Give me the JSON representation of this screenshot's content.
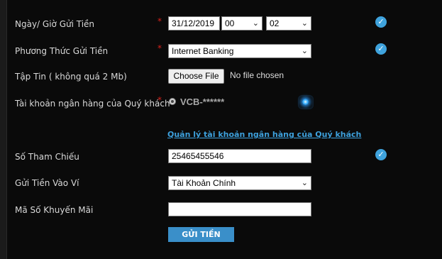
{
  "form": {
    "date_label": "Ngày/ Giờ Gửi Tiền",
    "date_value": "31/12/2019",
    "hour_value": "00",
    "minute_value": "02",
    "method_label": "Phương Thức Gửi Tiền",
    "method_value": "Internet Banking",
    "file_label": "Tập Tin ( không quá 2 Mb)",
    "file_button": "Choose File",
    "file_status": "No file chosen",
    "account_label": "Tài khoản ngân hàng của Quý khách",
    "account_option": "VCB-******",
    "manage_link": "Quản lý tài khoản ngân hàng của Quý khách",
    "reference_label": "Số Tham Chiếu",
    "reference_value": "25465455546",
    "wallet_label": "Gửi Tiền Vào Ví",
    "wallet_value": "Tài Khoản Chính",
    "promo_label": "Mã Số Khuyến Mãi",
    "promo_value": "",
    "submit_label": "GỬI TIỀN",
    "required_mark": "*"
  },
  "icons": {
    "check": "check-circle-icon",
    "chevron": "chevron-down-icon",
    "status": "status-light-icon"
  },
  "colors": {
    "background": "#0a0a0a",
    "accent": "#3fa3dd",
    "required": "#d8221c",
    "button": "#3a8fc9"
  }
}
